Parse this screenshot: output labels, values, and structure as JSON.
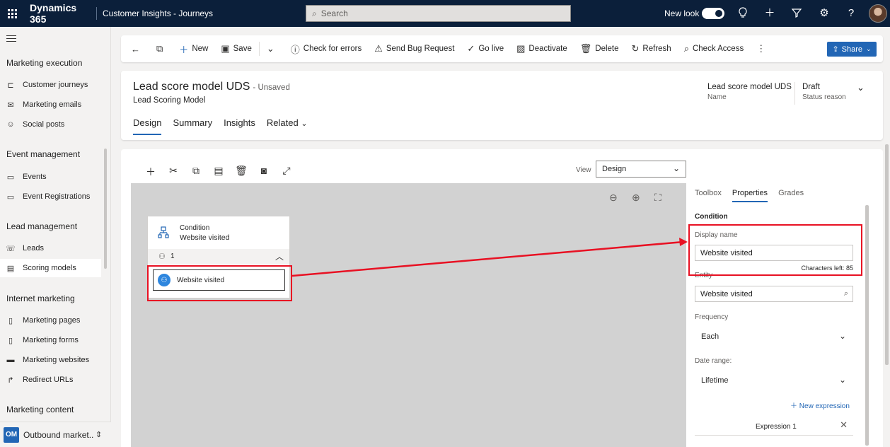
{
  "topbar": {
    "app_name": "Dynamics 365",
    "app_sub": "Customer Insights - Journeys",
    "search_placeholder": "Search",
    "new_look": "New look"
  },
  "sidebar": {
    "groups": [
      {
        "label": "Marketing execution",
        "items": [
          "Customer journeys",
          "Marketing emails",
          "Social posts"
        ]
      },
      {
        "label": "Event management",
        "items": [
          "Events",
          "Event Registrations"
        ]
      },
      {
        "label": "Lead management",
        "items": [
          "Leads",
          "Scoring models"
        ]
      },
      {
        "label": "Internet marketing",
        "items": [
          "Marketing pages",
          "Marketing forms",
          "Marketing websites",
          "Redirect URLs"
        ]
      },
      {
        "label": "Marketing content",
        "items": []
      }
    ],
    "active_item": "Scoring models",
    "area_badge": "OM",
    "area_label": "Outbound market..."
  },
  "commands": {
    "new": "New",
    "save": "Save",
    "check_errors": "Check for errors",
    "send_bug": "Send Bug Request",
    "go_live": "Go live",
    "deactivate": "Deactivate",
    "delete": "Delete",
    "refresh": "Refresh",
    "check_access": "Check Access",
    "share": "Share"
  },
  "record": {
    "title": "Lead score model UDS",
    "unsaved": "- Unsaved",
    "entity": "Lead Scoring Model",
    "name_value": "Lead score model UDS",
    "name_label": "Name",
    "status_value": "Draft",
    "status_label": "Status reason",
    "tabs": [
      "Design",
      "Summary",
      "Insights",
      "Related"
    ]
  },
  "designer": {
    "view_label": "View",
    "view_value": "Design",
    "condition_type": "Condition",
    "condition_name": "Website visited",
    "condition_count": "1",
    "item_label": "Website visited"
  },
  "properties": {
    "tabs": [
      "Toolbox",
      "Properties",
      "Grades"
    ],
    "section": "Condition",
    "display_name_label": "Display name",
    "display_name_value": "Website visited",
    "chars_left": "Characters left: 85",
    "entity_label": "Entity",
    "entity_value": "Website visited",
    "frequency_label": "Frequency",
    "frequency_value": "Each",
    "date_range_label": "Date range:",
    "date_range_value": "Lifetime",
    "new_expression": "New expression",
    "expression_label": "Expression 1"
  },
  "colors": {
    "topbar": "#0b1f3a",
    "accent": "#2266b5",
    "highlight": "#e81123",
    "canvas": "#d2d2d2"
  }
}
